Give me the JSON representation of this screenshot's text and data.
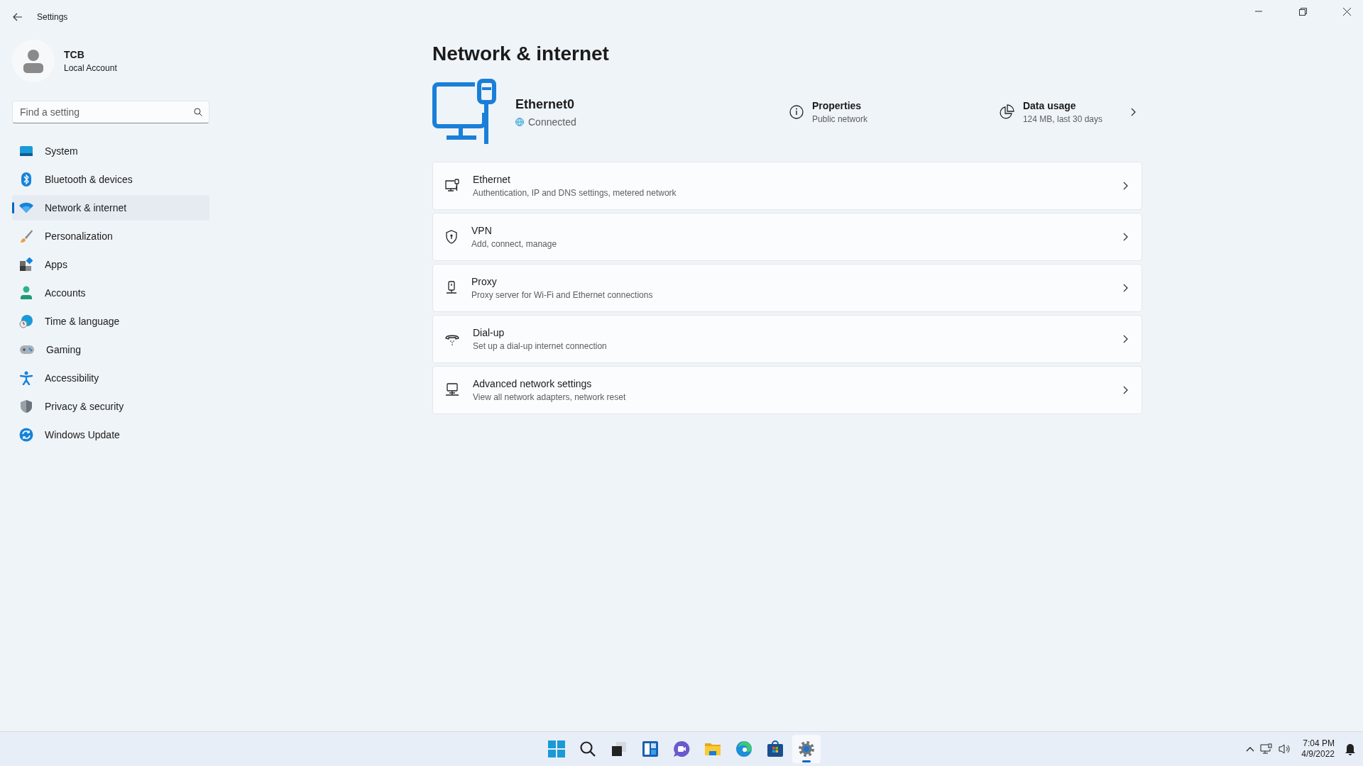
{
  "window": {
    "title": "Settings"
  },
  "account": {
    "name": "TCB",
    "type": "Local Account"
  },
  "search": {
    "placeholder": "Find a setting"
  },
  "sidebar": {
    "items": [
      {
        "label": "System",
        "selected": false
      },
      {
        "label": "Bluetooth & devices",
        "selected": false
      },
      {
        "label": "Network & internet",
        "selected": true
      },
      {
        "label": "Personalization",
        "selected": false
      },
      {
        "label": "Apps",
        "selected": false
      },
      {
        "label": "Accounts",
        "selected": false
      },
      {
        "label": "Time & language",
        "selected": false
      },
      {
        "label": "Gaming",
        "selected": false
      },
      {
        "label": "Accessibility",
        "selected": false
      },
      {
        "label": "Privacy & security",
        "selected": false
      },
      {
        "label": "Windows Update",
        "selected": false
      }
    ]
  },
  "page": {
    "title": "Network & internet"
  },
  "connection": {
    "name": "Ethernet0",
    "status": "Connected"
  },
  "properties": {
    "title": "Properties",
    "subtitle": "Public network"
  },
  "data_usage": {
    "title": "Data usage",
    "subtitle": "124 MB, last 30 days"
  },
  "cards": [
    {
      "title": "Ethernet",
      "subtitle": "Authentication, IP and DNS settings, metered network"
    },
    {
      "title": "VPN",
      "subtitle": "Add, connect, manage"
    },
    {
      "title": "Proxy",
      "subtitle": "Proxy server for Wi-Fi and Ethernet connections"
    },
    {
      "title": "Dial-up",
      "subtitle": "Set up a dial-up internet connection"
    },
    {
      "title": "Advanced network settings",
      "subtitle": "View all network adapters, network reset"
    }
  ],
  "taskbar": {
    "apps": [
      {
        "selected": false
      },
      {
        "selected": false
      },
      {
        "selected": false
      },
      {
        "selected": false
      },
      {
        "selected": false
      },
      {
        "selected": false
      },
      {
        "selected": false
      },
      {
        "selected": false
      },
      {
        "selected": true
      }
    ]
  },
  "tray": {
    "time": "7:04 PM",
    "date": "4/9/2022"
  }
}
